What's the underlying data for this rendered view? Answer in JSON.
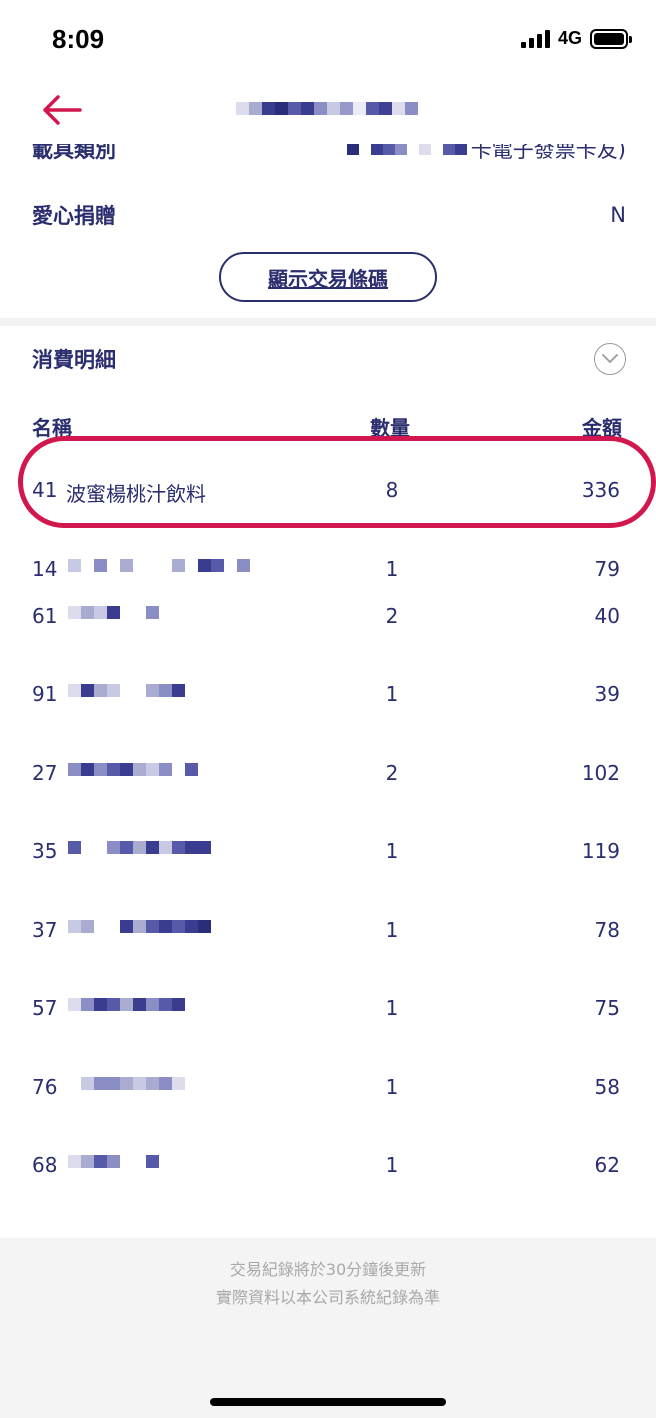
{
  "status": {
    "time": "8:09",
    "network": "4G"
  },
  "nav": {
    "back_icon": "arrow-left-icon",
    "accent": "#d2174f"
  },
  "info": {
    "carrier_label": "載具類別",
    "carrier_value_suffix": "卡電子發票卡友)",
    "donation_label": "愛心捐贈",
    "donation_value": "N",
    "barcode_button": "顯示交易條碼"
  },
  "details": {
    "title": "消費明細",
    "collapse_icon": "chevron-down-circle-icon",
    "headers": {
      "name": "名稱",
      "qty": "數量",
      "amount": "金額"
    },
    "items": [
      {
        "code": "41",
        "name": "波蜜楊桃汁飲料",
        "qty": "8",
        "amount": "336"
      },
      {
        "code": "14",
        "name": "",
        "qty": "1",
        "amount": "79"
      },
      {
        "code": "61",
        "name": "",
        "qty": "2",
        "amount": "40"
      },
      {
        "code": "91",
        "name": "",
        "qty": "1",
        "amount": "39"
      },
      {
        "code": "27",
        "name": "",
        "qty": "2",
        "amount": "102"
      },
      {
        "code": "35",
        "name": "",
        "qty": "1",
        "amount": "119"
      },
      {
        "code": "37",
        "name": "",
        "qty": "1",
        "amount": "78"
      },
      {
        "code": "57",
        "name": "",
        "qty": "1",
        "amount": "75"
      },
      {
        "code": "76",
        "name": "",
        "qty": "1",
        "amount": "58"
      },
      {
        "code": "68",
        "name": "",
        "qty": "1",
        "amount": "62"
      }
    ]
  },
  "footer": {
    "line1": "交易紀錄將於30分鐘後更新",
    "line2": "實際資料以本公司系統紀錄為準"
  },
  "colors": {
    "text": "#2a2d6e",
    "highlight": "#d2174f",
    "footer_bg": "#f4f4f4"
  }
}
